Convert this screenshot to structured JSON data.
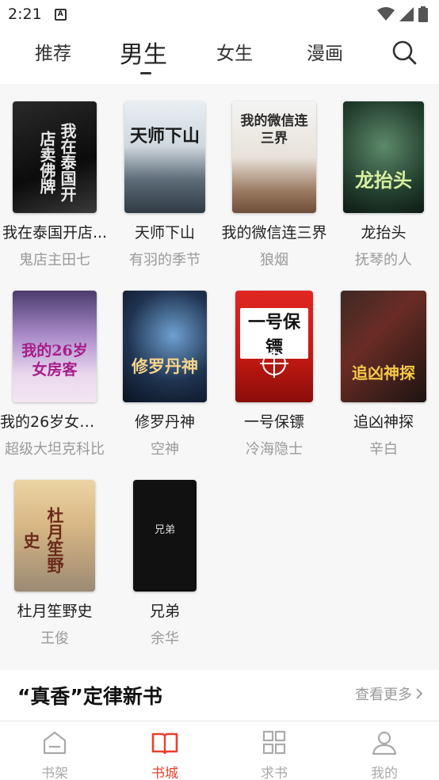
{
  "status_bar": {
    "time": "2:21",
    "app_icon": "A"
  },
  "top_nav": {
    "tabs": [
      {
        "label": "推荐",
        "active": false
      },
      {
        "label": "男生",
        "active": true
      },
      {
        "label": "女生",
        "active": false
      },
      {
        "label": "漫画",
        "active": false
      }
    ],
    "search_icon": "search-icon"
  },
  "books": [
    {
      "title": "我在泰国开店...",
      "author": "鬼店主田七",
      "cover_text": "我在泰国开店卖佛牌"
    },
    {
      "title": "天师下山",
      "author": "有羽的季节",
      "cover_text": "天师下山"
    },
    {
      "title": "我的微信连三界",
      "author": "狼烟",
      "cover_text": "我的微信连三界"
    },
    {
      "title": "龙抬头",
      "author": "抚琴的人",
      "cover_text": "龙抬头"
    },
    {
      "title": "我的26岁女房客",
      "author": "超级大坦克科比",
      "cover_text": "我的26岁女房客"
    },
    {
      "title": "修罗丹神",
      "author": "空神",
      "cover_text": "修罗丹神"
    },
    {
      "title": "一号保镖",
      "author": "冷海隐士",
      "cover_text": "一号保镖"
    },
    {
      "title": "追凶神探",
      "author": "辛白",
      "cover_text": "追凶神探"
    },
    {
      "title": "杜月笙野史",
      "author": "王俊",
      "cover_text": "杜月笙野史"
    },
    {
      "title": "兄弟",
      "author": "余华",
      "cover_text": "兄弟"
    }
  ],
  "section": {
    "title": "“真香”定律新书",
    "more_label": "查看更多"
  },
  "bottom_nav": [
    {
      "label": "书架",
      "icon": "bookshelf-icon",
      "active": false
    },
    {
      "label": "书城",
      "icon": "open-book-icon",
      "active": true
    },
    {
      "label": "求书",
      "icon": "grid-icon",
      "active": false
    },
    {
      "label": "我的",
      "icon": "user-icon",
      "active": false
    }
  ],
  "colors": {
    "accent": "#e8402e",
    "inactive": "#aaaaaa",
    "background": "#f7f7f7"
  }
}
